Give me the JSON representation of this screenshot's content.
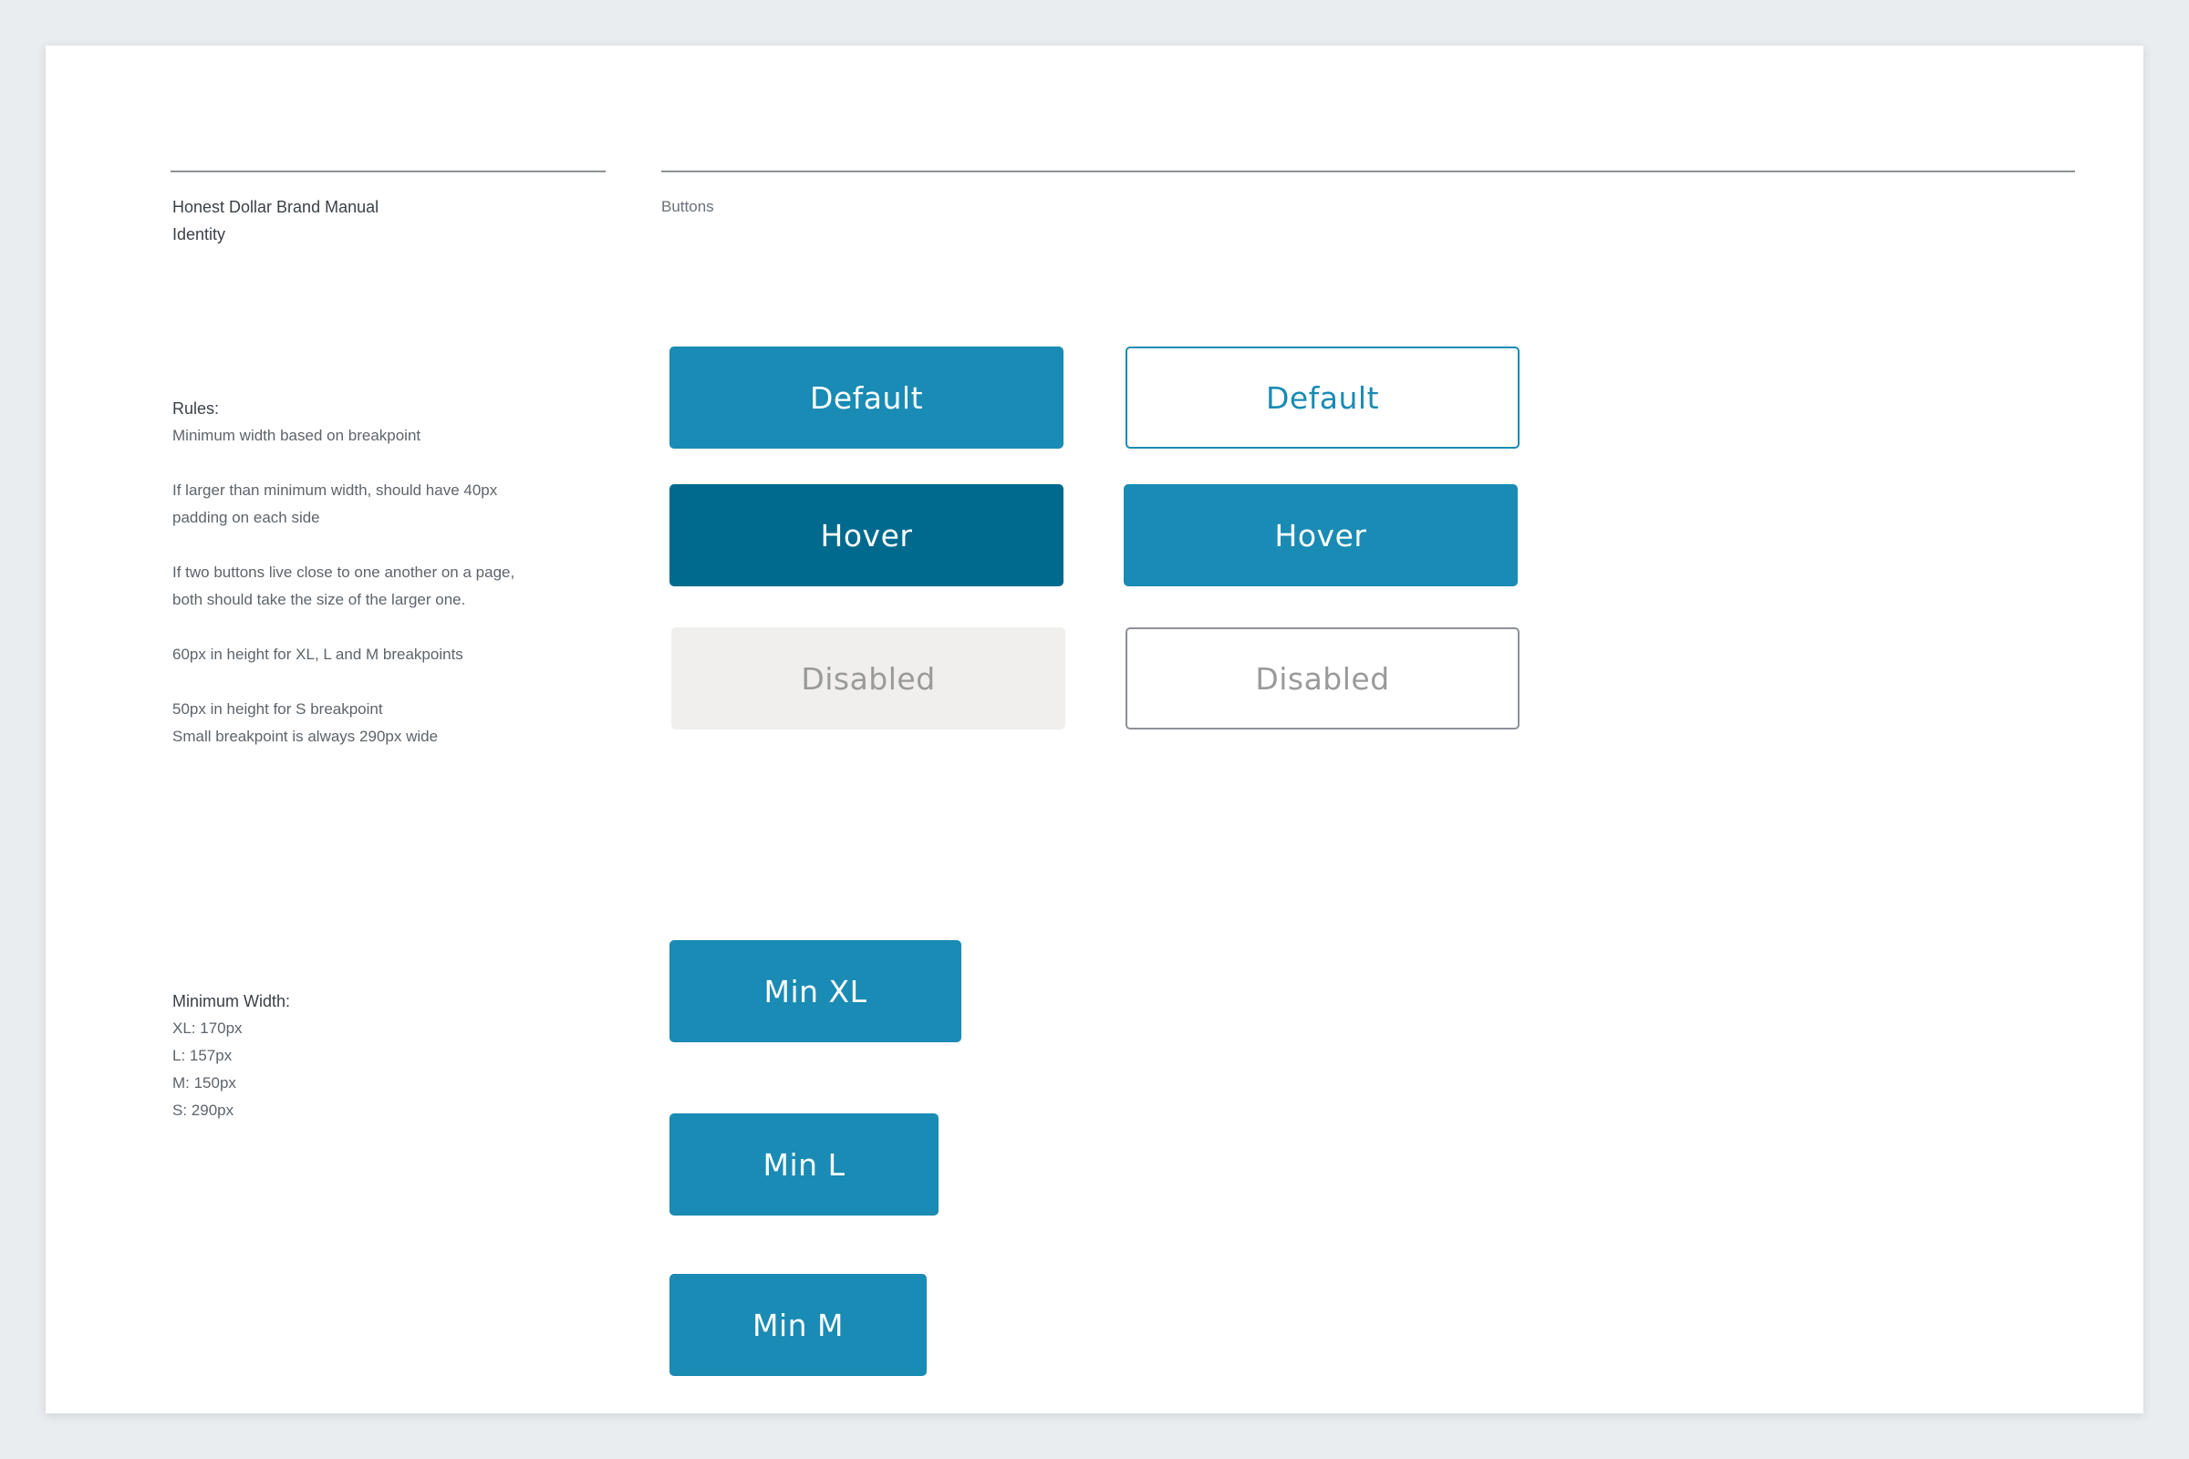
{
  "header": {
    "manual_title": "Honest Dollar Brand Manual",
    "section": "Identity",
    "page_topic": "Buttons"
  },
  "rules": {
    "title": "Rules:",
    "lines": [
      "Minimum width based on breakpoint",
      "If larger than minimum width, should have 40px",
      "padding on each side",
      "If two buttons live close to one another on a page,",
      "both should take the size of the larger one.",
      "60px in height for XL, L and M breakpoints",
      "50px in height for S breakpoint",
      "Small breakpoint is always 290px wide"
    ]
  },
  "min_width": {
    "title": "Minimum Width:",
    "lines": [
      "XL: 170px",
      "L: 157px",
      "M: 150px",
      "S: 290px"
    ]
  },
  "buttons": {
    "default_filled": "Default",
    "default_outline": "Default",
    "hover_filled": "Hover",
    "hover_outline": "Hover",
    "disabled_filled": "Disabled",
    "disabled_outline": "Disabled",
    "min_xl": "Min XL",
    "min_l": "Min L",
    "min_m": "Min M"
  },
  "colors": {
    "primary": "#1a8bb4",
    "primary_hover": "#00698e",
    "disabled_fill": "#f0efed",
    "disabled_text": "#9a9a9a",
    "background": "#e9edf0"
  }
}
